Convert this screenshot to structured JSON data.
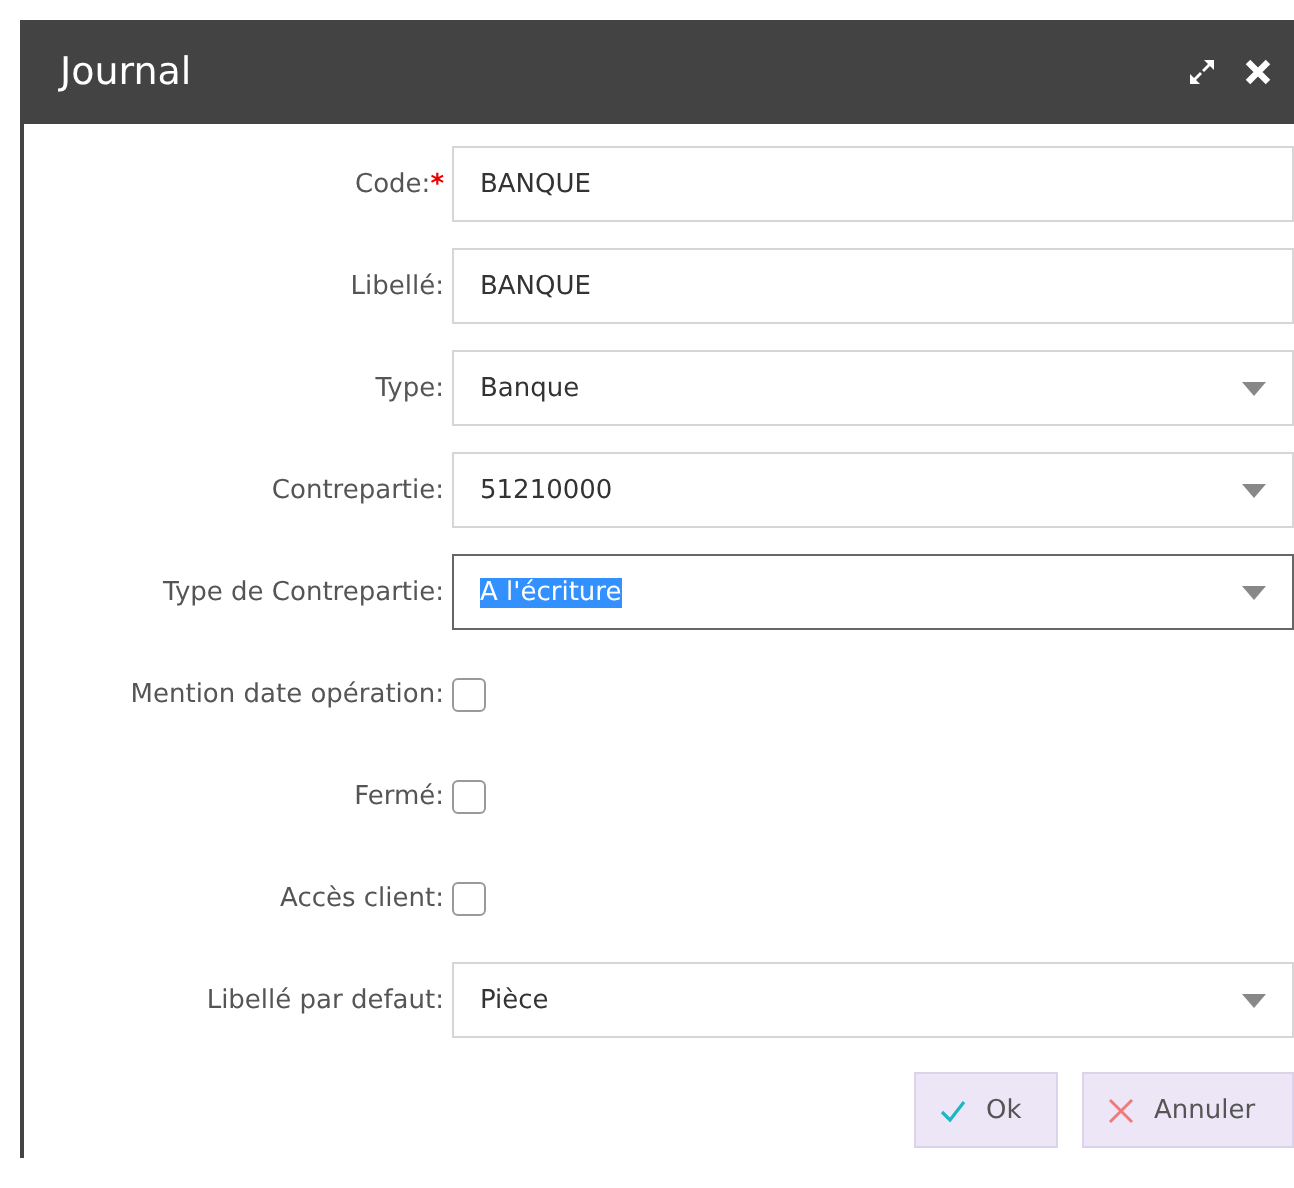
{
  "window": {
    "title": "Journal"
  },
  "fields": [
    {
      "kind": "text",
      "label": "Code:",
      "required_mark": "*",
      "value": "BANQUE",
      "focused": false
    },
    {
      "kind": "text",
      "label": "Libellé:",
      "value": "BANQUE",
      "focused": false
    },
    {
      "kind": "select",
      "label": "Type:",
      "value": "Banque",
      "focused": false
    },
    {
      "kind": "select",
      "label": "Contrepartie:",
      "value": "51210000",
      "focused": false
    },
    {
      "kind": "select",
      "label": "Type de Contrepartie:",
      "value": "A l'écriture",
      "focused": true
    },
    {
      "kind": "checkbox",
      "label": "Mention date opération:",
      "checked": false
    },
    {
      "kind": "checkbox",
      "label": "Fermé:",
      "checked": false
    },
    {
      "kind": "checkbox",
      "label": "Accès client:",
      "checked": false
    },
    {
      "kind": "select",
      "label": "Libellé par defaut:",
      "value": "Pièce",
      "focused": false
    }
  ],
  "buttons": [
    {
      "kind": "ok",
      "label": "Ok"
    },
    {
      "kind": "cancel",
      "label": "Annuler"
    }
  ]
}
